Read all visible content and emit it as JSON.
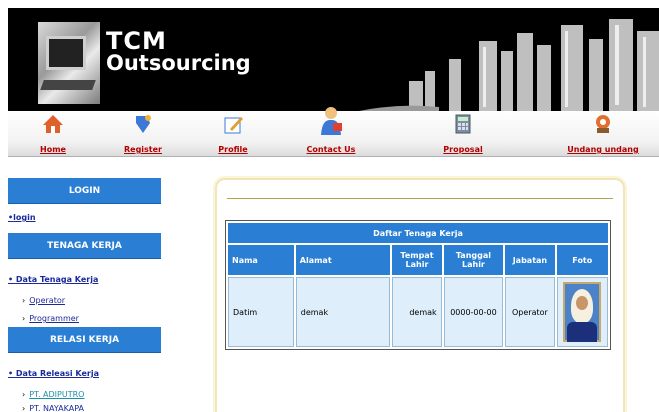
{
  "header": {
    "brand_line1": "TCM",
    "brand_line2": "Outsourcing"
  },
  "nav": {
    "items": [
      {
        "label": "Home",
        "icon": "home-icon"
      },
      {
        "label": "Register",
        "icon": "register-icon"
      },
      {
        "label": "Profile",
        "icon": "profile-edit-icon"
      },
      {
        "label": "Contact Us",
        "icon": "contact-person-icon"
      },
      {
        "label": "Proposal",
        "icon": "calculator-icon"
      },
      {
        "label": "Undang undang",
        "icon": "law-gear-icon"
      }
    ]
  },
  "sidebar": {
    "login_header": "LOGIN",
    "login_link": "login",
    "tenaga_header": "TENAGA KERJA",
    "tenaga_link": "Data Tenaga Kerja",
    "tenaga_subs": [
      "Operator",
      "Programmer"
    ],
    "relasi_header": "RELASI KERJA",
    "relasi_link": "Data Releasi Kerja",
    "relasi_subs": [
      "PT. ADIPUTRO",
      "PT. NAYAKAPA"
    ]
  },
  "table": {
    "caption": "Daftar Tenaga Kerja",
    "headers": {
      "nama": "Nama",
      "alamat": "Alamat",
      "tempat_lahir": "Tempat Lahir",
      "tanggal_lahir": "Tanggal Lahir",
      "jabatan": "Jabatan",
      "foto": "Foto"
    },
    "rows": [
      {
        "nama": "Datim",
        "alamat": "demak",
        "tempat_lahir": "demak",
        "tanggal_lahir": "0000-00-00",
        "jabatan": "Operator"
      }
    ]
  },
  "colors": {
    "nav_link": "#b20000",
    "sidebar_header": "#2a7fd4",
    "table_header": "#2a7fd4",
    "table_cell": "#deeefa"
  }
}
